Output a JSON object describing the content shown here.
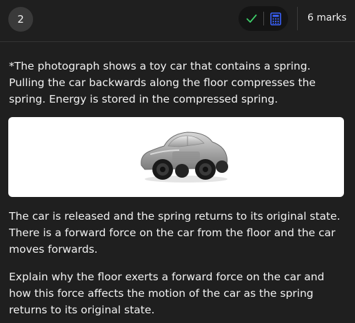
{
  "header": {
    "question_number": "2",
    "marks_label": "6 marks",
    "icons": {
      "check": "check-icon",
      "calculator": "calculator-icon"
    },
    "colors": {
      "check": "#3ecf6a",
      "calculator": "#3b63ff"
    }
  },
  "question": {
    "intro": "*The photograph shows a toy car that contains a spring. Pulling the car backwards along the floor compresses the spring. Energy is stored in the compressed spring.",
    "release_text": "The car is released and the spring returns to its original state. There is a forward force on the car from the floor and the car moves forwards.",
    "prompt": "Explain why the floor exerts a forward force on the car and how this force affects the motion of the car as the spring returns to its original state."
  }
}
